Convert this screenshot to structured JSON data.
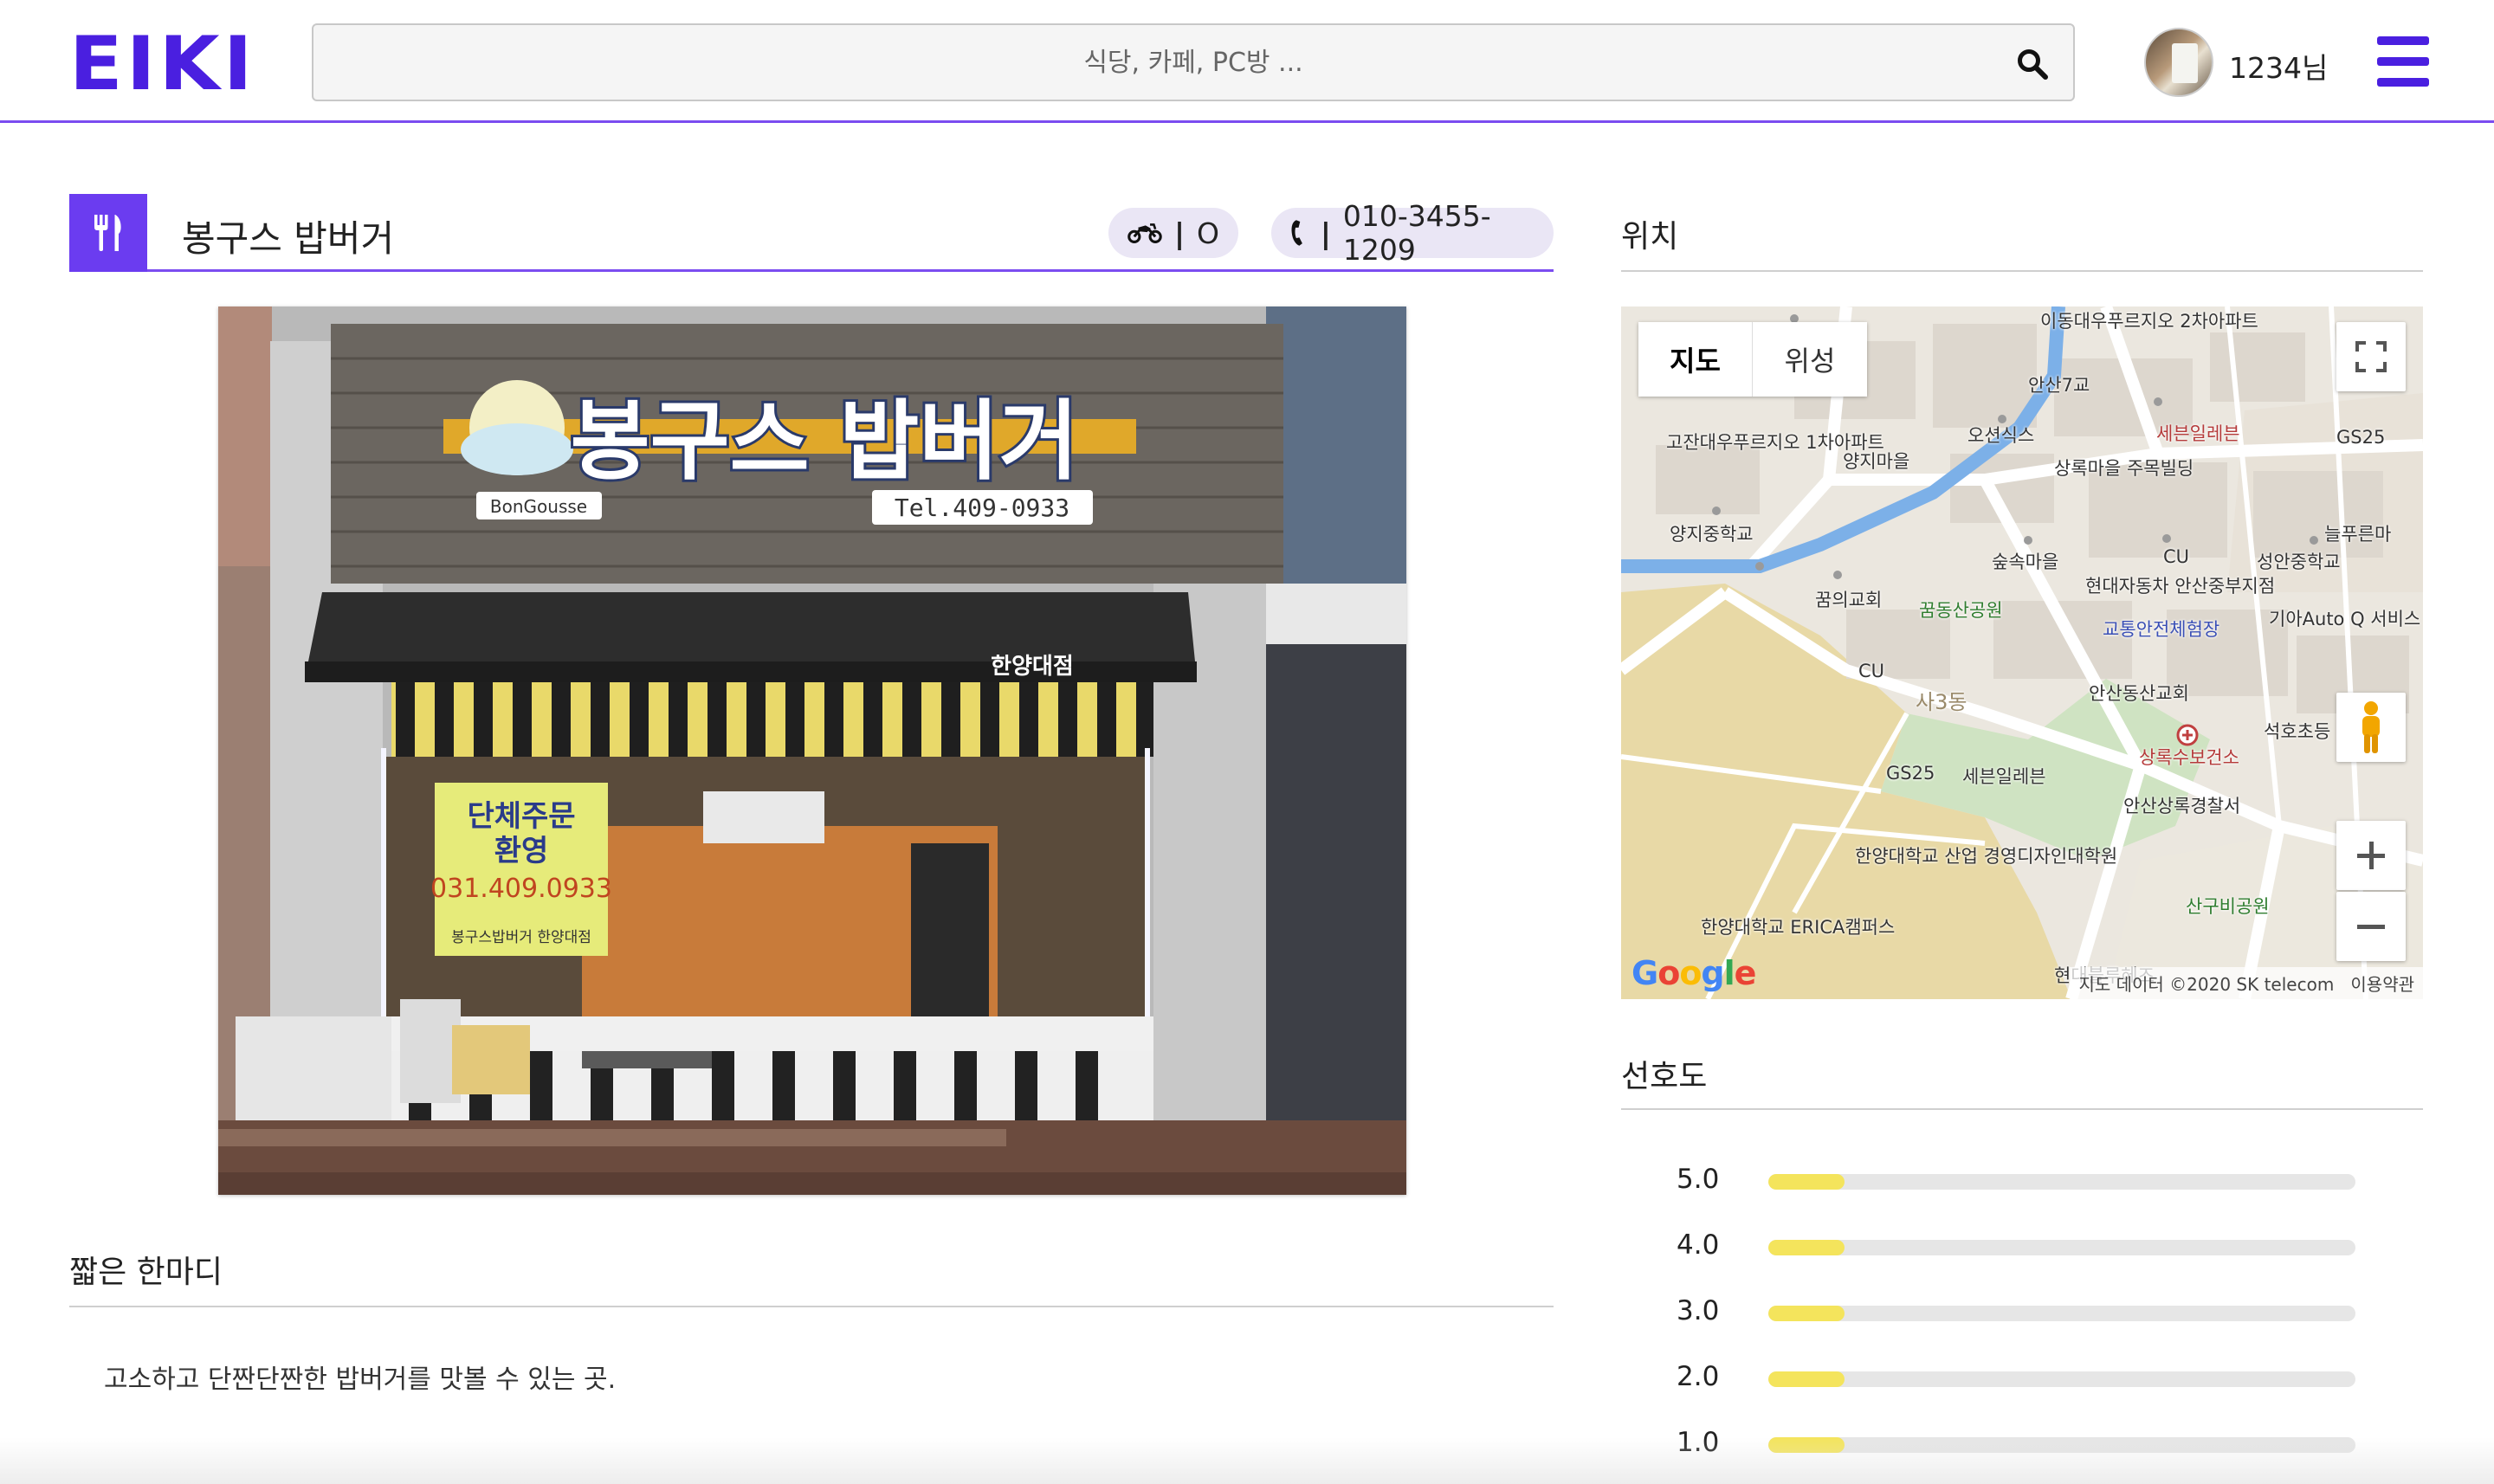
{
  "header": {
    "logo": "EIKI",
    "search_placeholder": "식당, 카페, PC방 ...",
    "username": "1234님"
  },
  "restaurant": {
    "name": "봉구스 밥버거",
    "delivery_value": "O",
    "phone": "010-3455-1209",
    "photo_sign_name": "봉구스 밥버거",
    "photo_sign_brand": "BonGousse",
    "photo_sign_tel": "Tel.409-0933",
    "photo_awning_text": "한양대점",
    "photo_poster_line1": "단체주문",
    "photo_poster_line2": "환영",
    "photo_poster_phone": "031.409.0933",
    "photo_poster_note": "봉구스밥버거 한양대점"
  },
  "comment": {
    "title": "짧은 한마디",
    "text": "고소하고 단짠단짠한 밥버거를 맛볼 수 있는 곳."
  },
  "location": {
    "title": "위치",
    "map_tabs": [
      "지도",
      "위성"
    ],
    "attribution": "지도 데이터 ©2020 SK telecom",
    "terms": "이용약관",
    "google_logo": "Google",
    "labels": [
      "이동대우푸르지오 2차아파트",
      "안산7교",
      "고잔대우푸르지오 1차아파트",
      "양지마을",
      "오션식스",
      "세븐일레븐",
      "GS25",
      "상록마을 주목빌딩",
      "양지중학교",
      "늘푸른마",
      "CU",
      "숲속마을",
      "성안중학교",
      "꿈의교회",
      "꿈동산공원",
      "현대자동차 안산중부지점",
      "교통안전체험장",
      "기아Auto Q 서비스 사동점",
      "CU",
      "사3동",
      "안산동산교회",
      "석호초등",
      "상록수보건소",
      "GS25",
      "세븐일레븐",
      "안산상록경찰서",
      "한양대학교 산업 경영디자인대학원",
      "한양대학교 ERICA캠퍼스",
      "산구비공원",
      "현대블루헤즈"
    ]
  },
  "preference": {
    "title": "선호도",
    "ratings": [
      {
        "label": "5.0",
        "fraction": 0.13
      },
      {
        "label": "4.0",
        "fraction": 0.13
      },
      {
        "label": "3.0",
        "fraction": 0.13
      },
      {
        "label": "2.0",
        "fraction": 0.13
      },
      {
        "label": "1.0",
        "fraction": 0.13
      }
    ]
  },
  "colors": {
    "brand": "#4a1fe0",
    "accent": "#7b4cf0",
    "pill_bg": "#eae6f5",
    "rating_fill": "#f4e45c"
  },
  "icons": [
    "search-icon",
    "hamburger-menu-icon",
    "utensils-icon",
    "motorcycle-icon",
    "phone-icon",
    "fullscreen-icon",
    "pegman-icon",
    "zoom-in-icon",
    "zoom-out-icon"
  ]
}
